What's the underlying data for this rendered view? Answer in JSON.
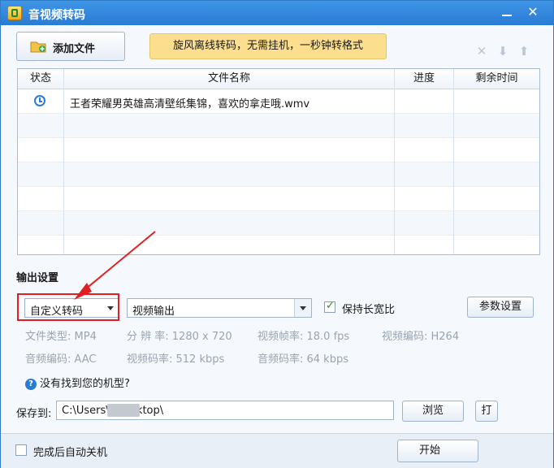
{
  "window": {
    "title": "音视频转码"
  },
  "toolbar": {
    "add_file_label": "添加文件",
    "banner_text": "旋风离线转码，无需挂机，一秒钟转格式"
  },
  "table": {
    "headers": [
      "状态",
      "文件名称",
      "进度",
      "剩余时间"
    ],
    "rows": [
      {
        "status_icon": "clock-icon",
        "filename": "王者荣耀男英雄高清壁纸集锦，喜欢的拿走哦.wmv",
        "progress": "",
        "remaining": ""
      }
    ]
  },
  "output": {
    "section_title": "输出设置",
    "preset_value": "自定义转码",
    "format_value": "视频输出",
    "keep_ratio_label": "保持长宽比",
    "keep_ratio_checked": true,
    "param_button": "参数设置",
    "info": {
      "file_type": "文件类型: MP4",
      "resolution": "分 辨 率:  1280 x 720",
      "frame_rate": "视频帧率:  18.0 fps",
      "video_codec": "视频编码:  H264",
      "audio_codec": "音频编码:  AAC",
      "video_bitrate": "视频码率:  512 kbps",
      "audio_bitrate": "音频码率:  64 kbps"
    },
    "help_text": "没有找到您的机型?"
  },
  "save": {
    "label": "保存到:",
    "path": "C:\\Users\\            \\Desktop\\",
    "browse_label": "浏览",
    "open_label": "打"
  },
  "footer": {
    "shutdown_label": "完成后自动关机",
    "start_label": "开始"
  },
  "colors": {
    "title_bar": "#2a7bd4",
    "banner": "#fbdf8f",
    "highlight": "#e02020"
  }
}
